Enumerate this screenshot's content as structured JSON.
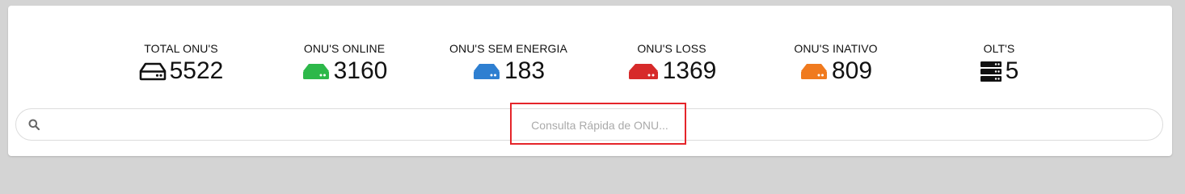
{
  "stats": [
    {
      "label": "TOTAL ONU'S",
      "value": "5522",
      "icon": "hdd-outline-icon",
      "color": "#111111"
    },
    {
      "label": "ONU'S ONLINE",
      "value": "3160",
      "icon": "hdd-icon",
      "color": "#2db84a"
    },
    {
      "label": "ONU'S SEM ENERGIA",
      "value": "183",
      "icon": "hdd-icon",
      "color": "#2e7fd1"
    },
    {
      "label": "ONU'S LOSS",
      "value": "1369",
      "icon": "hdd-icon",
      "color": "#d72a2a"
    },
    {
      "label": "ONU'S INATIVO",
      "value": "809",
      "icon": "hdd-icon",
      "color": "#f07a1e"
    },
    {
      "label": "OLT'S",
      "value": "5",
      "icon": "server-icon",
      "color": "#111111"
    }
  ],
  "search": {
    "placeholder": "Consulta Rápida de ONU...",
    "icon": "search-icon"
  },
  "highlight_color": "#e5252a"
}
